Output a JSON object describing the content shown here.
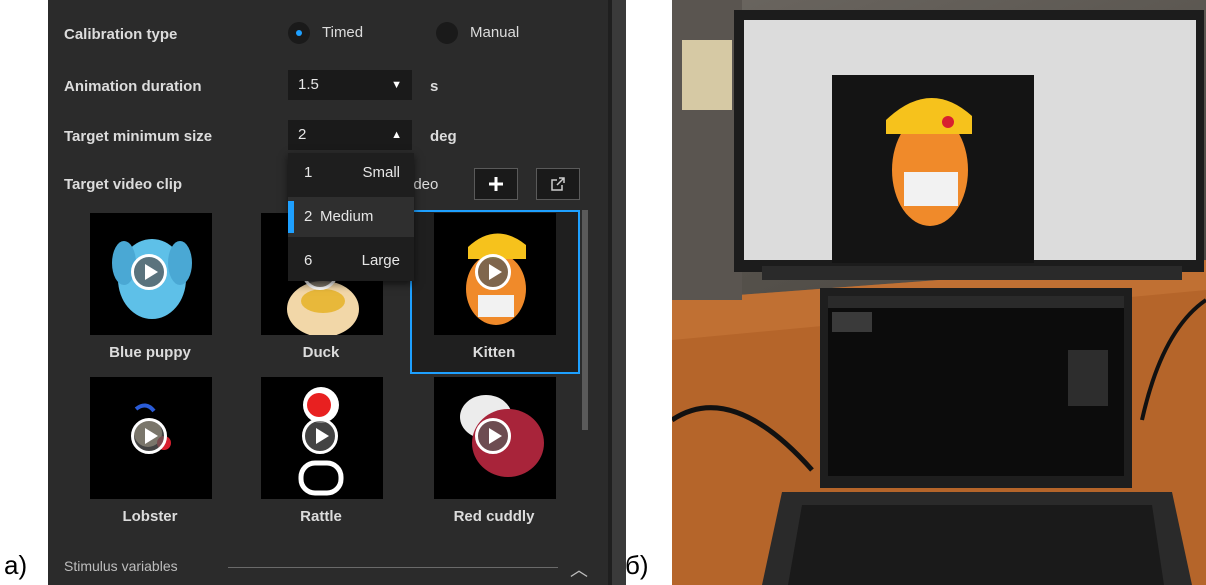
{
  "figure_labels": {
    "a": "а)",
    "b": "б)"
  },
  "settings": {
    "calibration_type_label": "Calibration type",
    "calibration_options": [
      {
        "label": "Timed",
        "selected": true
      },
      {
        "label": "Manual",
        "selected": false
      }
    ],
    "animation_duration_label": "Animation duration",
    "animation_duration_value": "1.5",
    "animation_duration_unit": "s",
    "target_min_size_label": "Target minimum size",
    "target_min_size_value": "2",
    "target_min_size_unit": "deg",
    "size_options": [
      {
        "num": "1",
        "name": "Small",
        "selected": false
      },
      {
        "num": "2",
        "name": "Medium",
        "selected": true
      },
      {
        "num": "6",
        "name": "Large",
        "selected": false
      }
    ],
    "target_video_clip_label": "Target video clip",
    "video_label_tail": "ideo",
    "add_icon": "plus-icon",
    "external_icon": "open-external-icon"
  },
  "clips": [
    {
      "name": "Blue puppy",
      "selected": false
    },
    {
      "name": "Duck",
      "selected": false
    },
    {
      "name": "Kitten",
      "selected": true
    },
    {
      "name": "Lobster",
      "selected": false
    },
    {
      "name": "Rattle",
      "selected": false
    },
    {
      "name": "Red cuddly",
      "selected": false
    }
  ],
  "stimulus_variables_label": "Stimulus variables",
  "colors": {
    "accent": "#1ea0ff",
    "panel_bg": "#2b2b2b",
    "control_bg": "#1a1a1a"
  }
}
